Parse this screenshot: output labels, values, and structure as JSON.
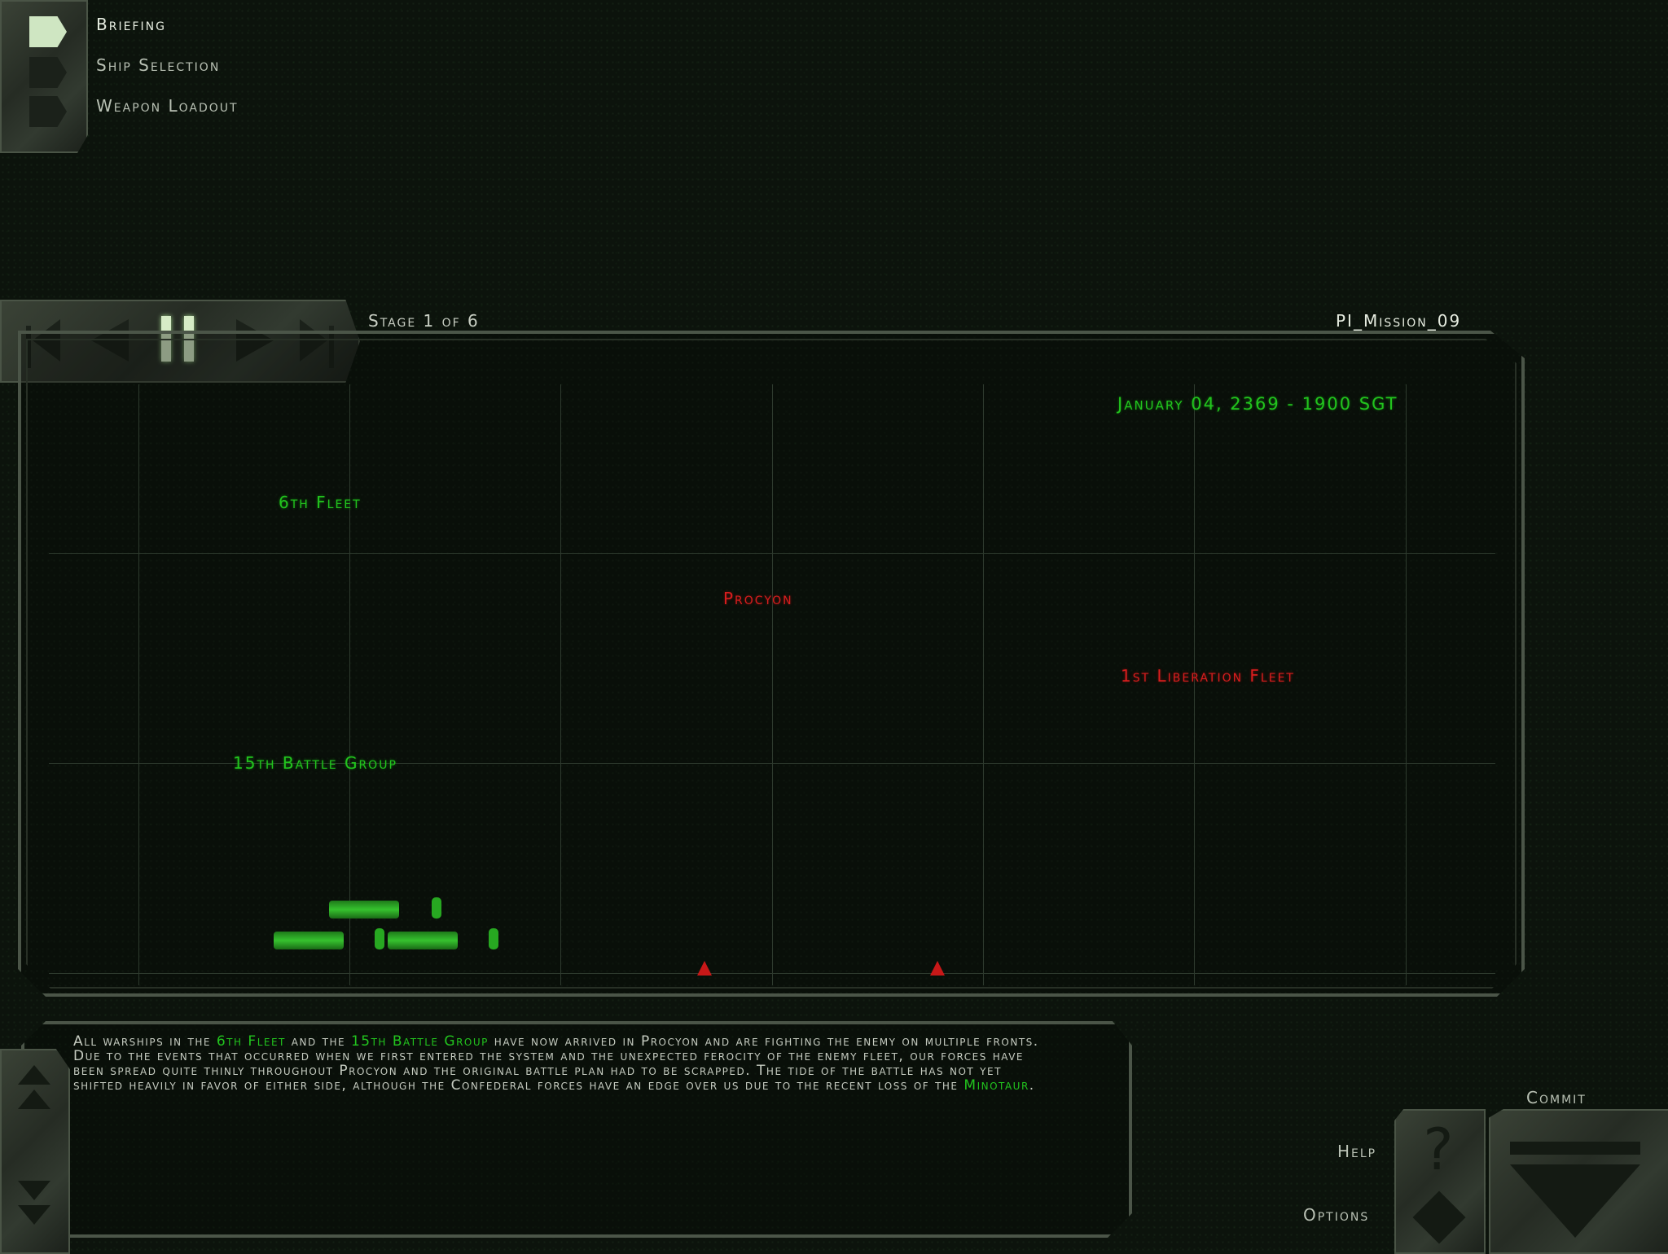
{
  "menu": {
    "items": [
      {
        "label": "Briefing"
      },
      {
        "label": "Ship Selection"
      },
      {
        "label": "Weapon Loadout"
      }
    ]
  },
  "playback": {
    "stage": "Stage 1 of 6",
    "mission": "PI_Mission_09"
  },
  "map": {
    "datetime": "January 04, 2369 - 1900 SGT",
    "labels": {
      "sixth_fleet": "6th Fleet",
      "procyon": "Procyon",
      "liberation_fleet": "1st Liberation Fleet",
      "battle_group": "15th Battle Group"
    }
  },
  "briefing": {
    "parts": [
      "All warships in the ",
      "6th Fleet",
      " and the ",
      "15th Battle Group",
      " have now arrived in Procyon and are fighting the enemy on multiple fronts. Due to the events that occurred when we first entered the system and the unexpected ferocity of the enemy fleet, our forces have been spread quite thinly throughout Procyon and the original battle plan had to be scrapped. The tide of the battle has not yet shifted heavily in favor of either side, although the Confederal forces have an edge over us due to the recent loss of the ",
      "Minotaur",
      "."
    ]
  },
  "actions": {
    "commit": "Commit",
    "help": "Help",
    "options": "Options"
  },
  "colors": {
    "friendly": "#22c41e",
    "enemy": "#d81e1e",
    "frame": "#4b5548"
  }
}
